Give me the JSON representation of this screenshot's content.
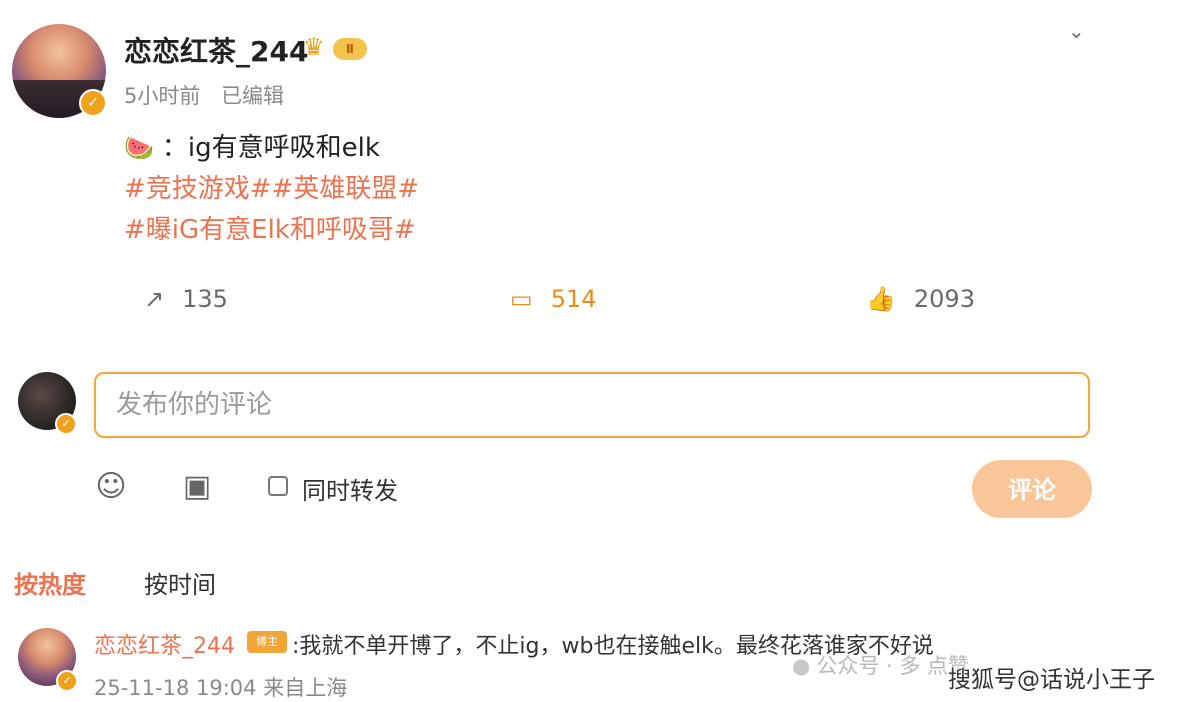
{
  "post": {
    "username": "恋恋红茶_244",
    "level_badge": "Ⅱ",
    "time": "5小时前",
    "edited": "已编辑",
    "emoji": "🍉",
    "text_line": "：ig有意呼吸和elk",
    "hashtags_line1": "#竞技游戏##英雄联盟#",
    "hashtags_line2": "#曝iG有意Elk和呼吸哥#",
    "actions": {
      "repost_count": "135",
      "comment_count": "514",
      "like_count": "2093"
    }
  },
  "composer": {
    "placeholder": "发布你的评论",
    "repost_label": "同时转发",
    "submit_label": "评论"
  },
  "sort": {
    "hot": "按热度",
    "time": "按时间"
  },
  "comment": {
    "username": "恋恋红茶_244",
    "badge": "博主",
    "text": ":我就不单开博了，不止ig，wb也在接触elk。最终花落谁家不好说",
    "date": "25-11-18 19:04",
    "location": "来自上海"
  },
  "watermarks": {
    "wechat": "公众号 · 多 点赞",
    "sohu": "搜狐号@话说小王子"
  },
  "icons": {
    "expand": "chevron-down-icon",
    "repost": "repost-icon",
    "comment": "comment-icon",
    "like": "thumbs-up-icon",
    "emoji": "smiley-icon",
    "image": "image-icon"
  },
  "colors": {
    "accent": "#eb7350",
    "highlight": "#e98b1d",
    "input_border": "#f3a73e",
    "submit_bg": "#f9c69a"
  }
}
